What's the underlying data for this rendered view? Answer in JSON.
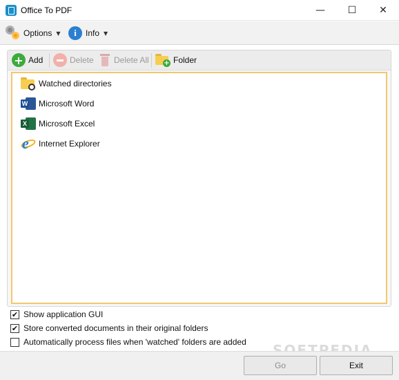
{
  "window": {
    "title": "Office To PDF",
    "minimize_glyph": "—",
    "maximize_glyph": "☐",
    "close_glyph": "✕"
  },
  "menu": {
    "options_label": "Options",
    "info_label": "Info",
    "caret": "▼",
    "info_glyph": "i"
  },
  "toolbar": {
    "add_label": "Add",
    "delete_label": "Delete",
    "delete_all_label": "Delete All",
    "folder_label": "Folder",
    "add_glyph": "+",
    "folder_plus_glyph": "+"
  },
  "list": {
    "items": [
      {
        "label": "Watched directories",
        "icon": "watched-folder-icon"
      },
      {
        "label": "Microsoft Word",
        "icon": "word-icon",
        "glyph": "W"
      },
      {
        "label": "Microsoft Excel",
        "icon": "excel-icon",
        "glyph": "X"
      },
      {
        "label": "Internet Explorer",
        "icon": "ie-icon",
        "glyph": "e"
      }
    ]
  },
  "checkboxes": [
    {
      "label": "Show application GUI",
      "checked": true
    },
    {
      "label": "Store converted documents in their original folders",
      "checked": true
    },
    {
      "label": "Automatically process files when 'watched' folders are added",
      "checked": false
    }
  ],
  "check_glyph": "✔",
  "buttons": {
    "go_label": "Go",
    "exit_label": "Exit"
  },
  "watermark": "SOFTPEDIA",
  "colors": {
    "accent_border": "#f2c86c",
    "add_green": "#3cab3c",
    "info_blue": "#2b7fd1"
  }
}
